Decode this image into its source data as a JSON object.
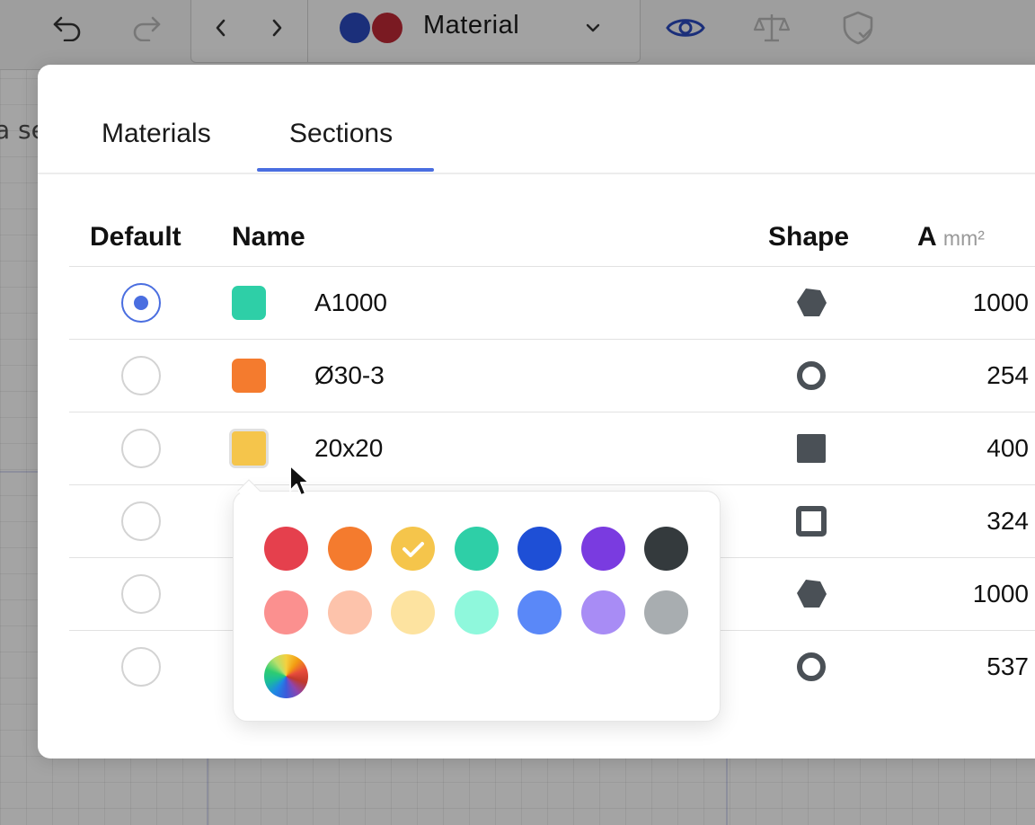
{
  "toolbar": {
    "undo_icon": "undo-icon",
    "redo_icon": "redo-icon",
    "prev_icon": "chevron-left-icon",
    "next_icon": "chevron-right-icon",
    "material_label": "Material",
    "material_colors": [
      "#1b2f7a",
      "#7a1a22"
    ],
    "view_icon": "eye-icon",
    "scale_icon": "balance-scale-icon",
    "shield_icon": "shield-check-icon"
  },
  "background": {
    "partial_text": "a se"
  },
  "modal": {
    "tabs": [
      {
        "label": "Materials",
        "active": false
      },
      {
        "label": "Sections",
        "active": true
      }
    ],
    "columns": {
      "default": "Default",
      "name": "Name",
      "shape": "Shape",
      "area": "A",
      "area_unit": "mm²"
    },
    "rows": [
      {
        "default": true,
        "color": "#2ecfa7",
        "name": "A1000",
        "shape": "hexagon-filled",
        "area": "1000"
      },
      {
        "default": false,
        "color": "#f47b2e",
        "name": "Ø30-3",
        "shape": "circle-hollow",
        "area": "254"
      },
      {
        "default": false,
        "color": "#f5c54b",
        "name": "20x20",
        "shape": "square-filled",
        "area": "400"
      },
      {
        "default": false,
        "color": "",
        "name": "",
        "shape": "square-hollow",
        "area": "324"
      },
      {
        "default": false,
        "color": "",
        "name": "",
        "shape": "hexagon-filled",
        "area": "1000"
      },
      {
        "default": false,
        "color": "",
        "name": "",
        "shape": "circle-hollow",
        "area": "537"
      }
    ]
  },
  "color_picker": {
    "selected": "#f5c54b",
    "colors_row1": [
      "#e5404d",
      "#f47b2e",
      "#f5c54b",
      "#2ecfa7",
      "#1e4fd6",
      "#7a3be0",
      "#343a3d"
    ],
    "colors_row2": [
      "#fb908f",
      "#fdc3ab",
      "#fde3a0",
      "#8ff8dc",
      "#5a88f8",
      "#a88cf5",
      "#a8adb0"
    ],
    "custom_icon": "color-wheel-icon",
    "check_icon": "checkmark-icon"
  },
  "cursor_icon": "mouse-pointer-icon"
}
